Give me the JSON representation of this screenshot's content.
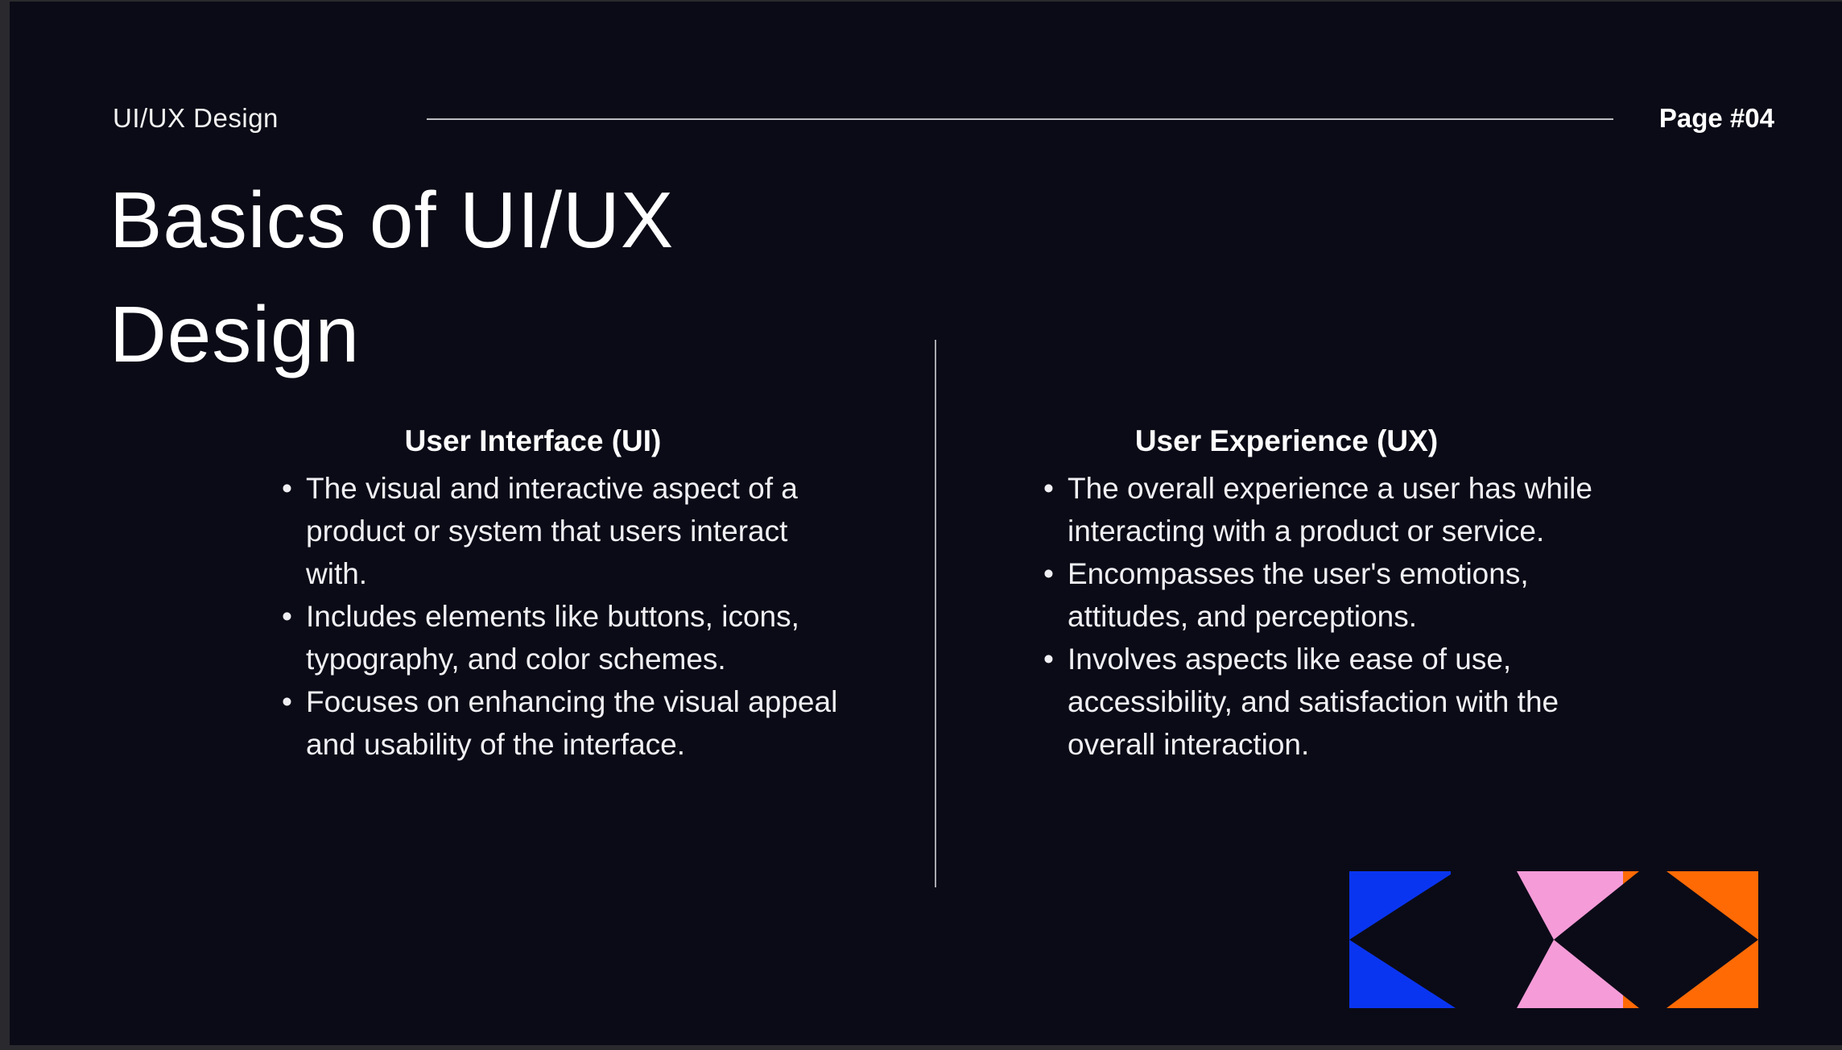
{
  "header": {
    "label": "UI/UX Design",
    "page": "Page #04"
  },
  "title": {
    "line1": "Basics of UI/UX",
    "line2": "Design"
  },
  "columns": [
    {
      "heading": "User Interface (UI)",
      "points": [
        "The visual and interactive aspect of a product or system that users interact with.",
        "Includes elements like buttons, icons, typography, and color schemes.",
        "Focuses on enhancing the visual appeal and usability of the interface."
      ]
    },
    {
      "heading": "User Experience (UX)",
      "points": [
        "The overall experience a user has while interacting with a product or service.",
        "Encompasses the user's emotions, attitudes, and perceptions.",
        "Involves aspects like ease of use, accessibility, and satisfaction with the overall interaction."
      ]
    }
  ],
  "colors": {
    "background": "#0b0b17",
    "blue": "#0a35f0",
    "pink": "#f59bd8",
    "orange": "#ff6a05"
  }
}
